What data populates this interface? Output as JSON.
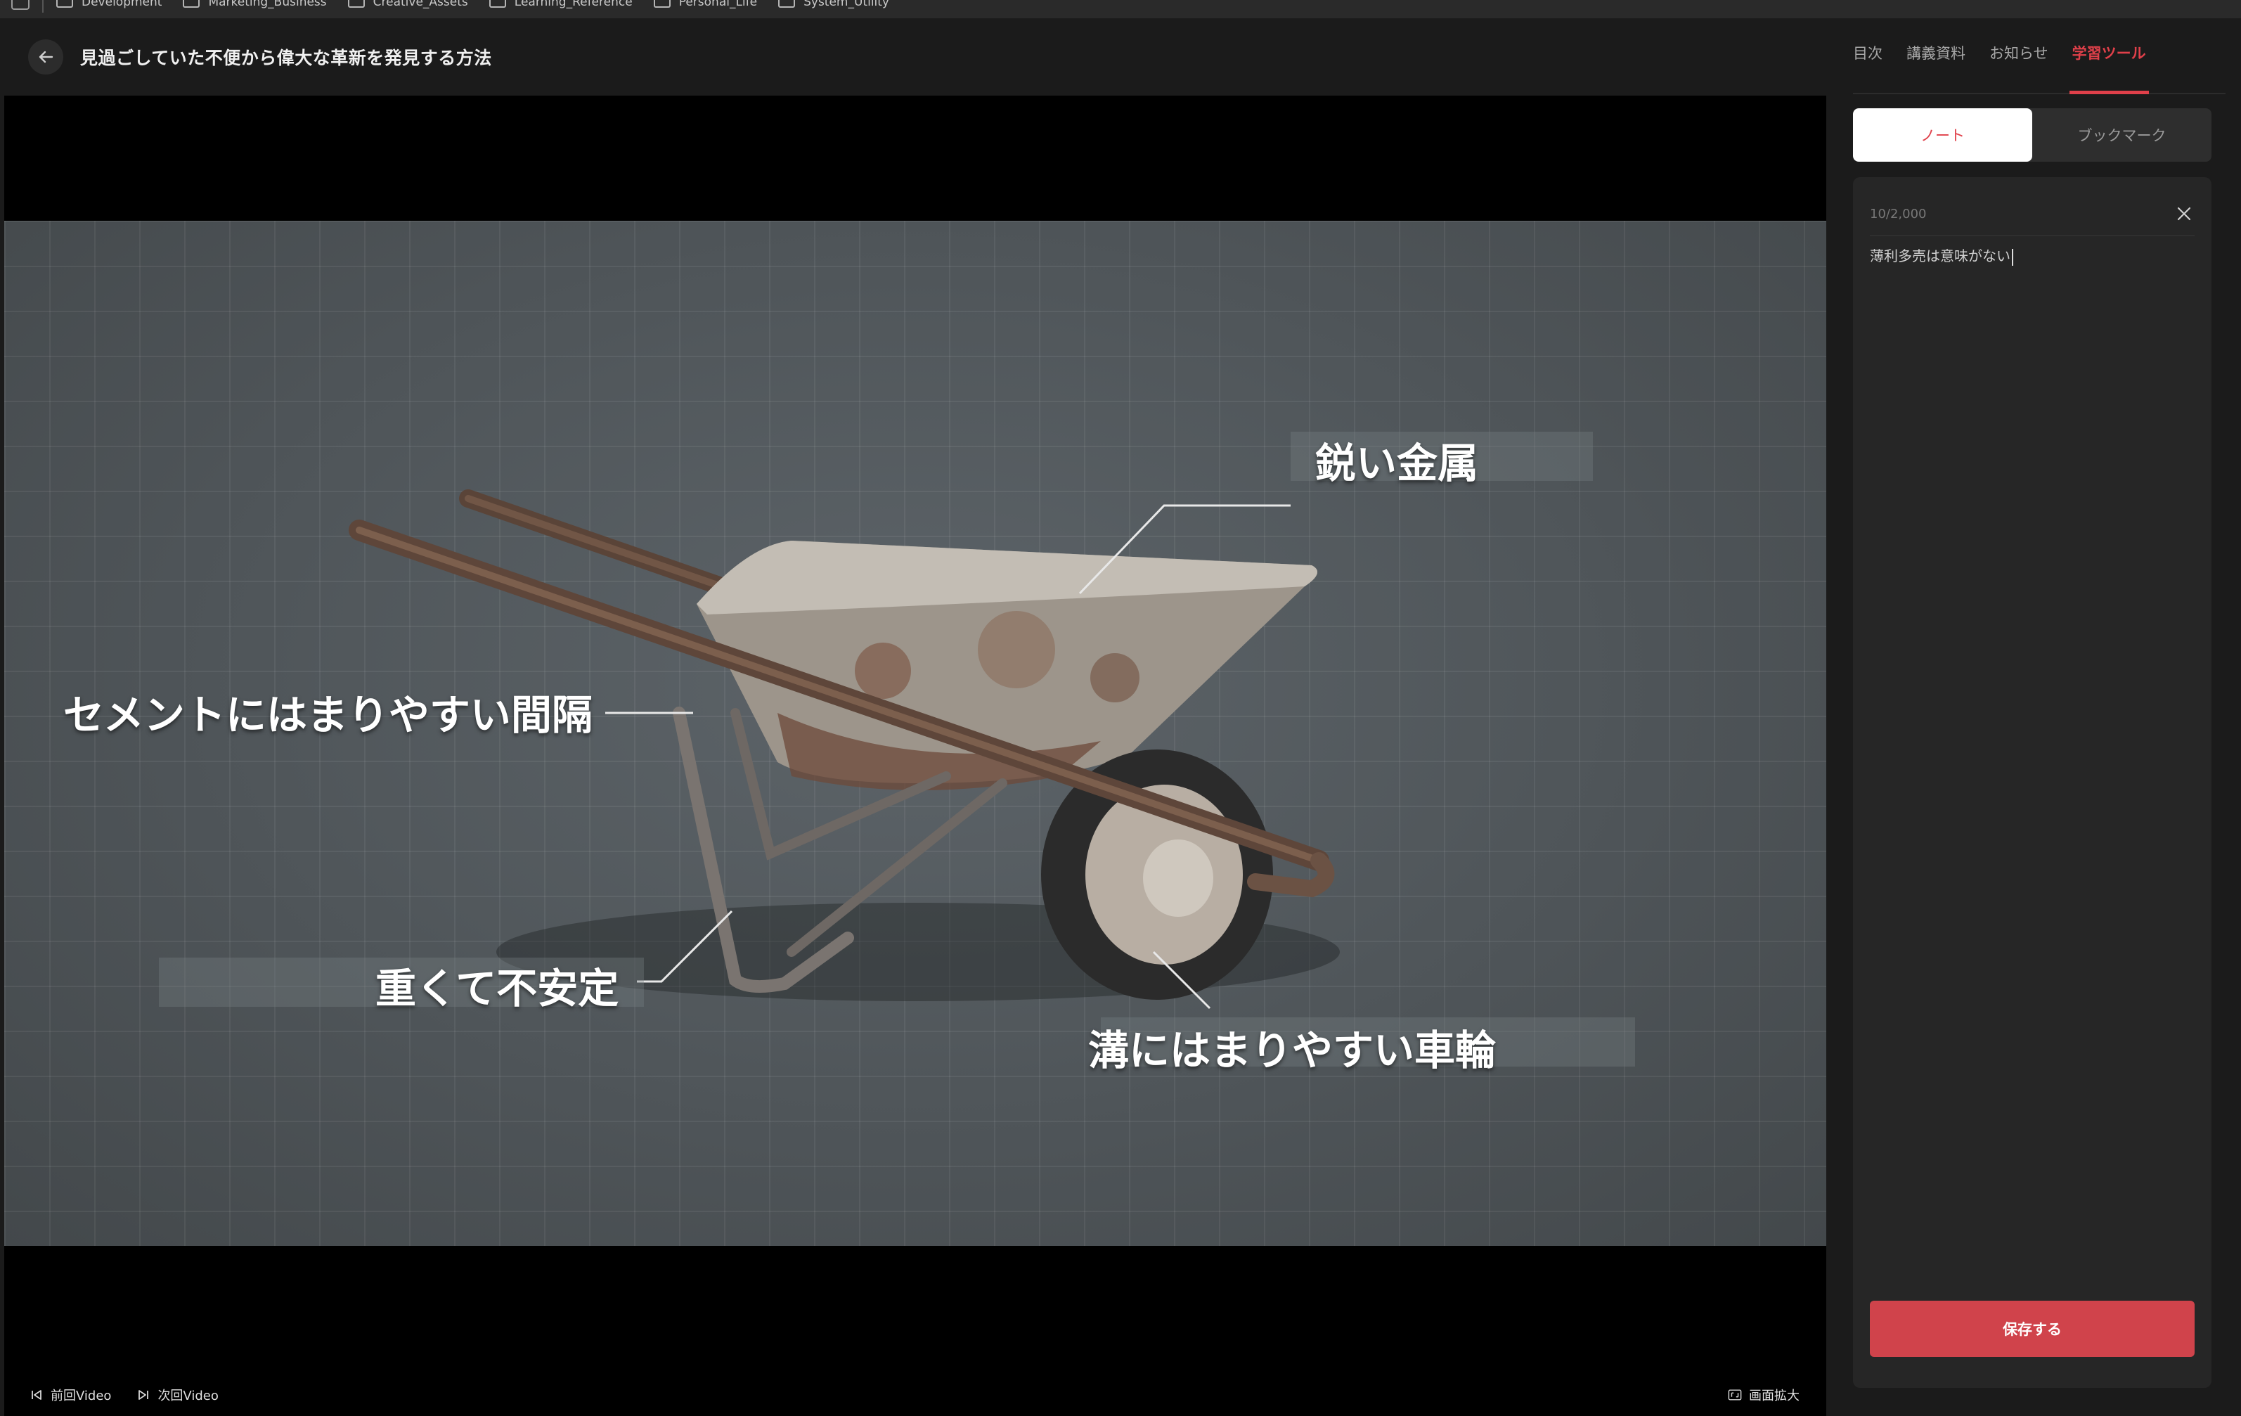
{
  "bookmarks": [
    "Development",
    "Marketing_Business",
    "Creative_Assets",
    "Learning_Reference",
    "Personal_Life",
    "System_Utility"
  ],
  "header": {
    "title": "見過ごしていた不便から偉大な革新を発見する方法"
  },
  "video": {
    "captions": {
      "sharp_metal": "鋭い金属",
      "cement_gap": "セメントにはまりやすい間隔",
      "heavy_unstable": "重くて不安定",
      "wheel_ditch": "溝にはまりやすい車輪"
    }
  },
  "player_controls": {
    "prev_label": "前回Video",
    "next_label": "次回Video",
    "expand_label": "画面拡大"
  },
  "side_panel": {
    "tabs": [
      {
        "label": "目次",
        "active": false
      },
      {
        "label": "講義資料",
        "active": false
      },
      {
        "label": "お知らせ",
        "active": false
      },
      {
        "label": "学習ツール",
        "active": true
      }
    ],
    "segments": {
      "note": "ノート",
      "bookmark": "ブックマーク",
      "active": "note"
    },
    "note": {
      "char_count": "10/2,000",
      "text": "薄利多売は意味がない",
      "save_label": "保存する"
    }
  },
  "colors": {
    "accent": "#e0404a",
    "save_button": "#d0434b",
    "panel_bg": "#1b1b1b",
    "card_bg": "#262626"
  }
}
